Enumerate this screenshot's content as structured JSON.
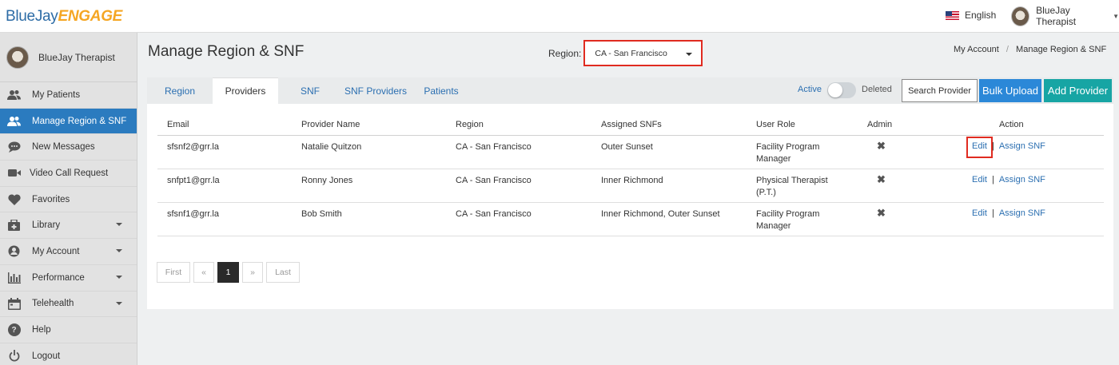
{
  "brand": {
    "part1": "BlueJay",
    "part2": "ENGAGE"
  },
  "header": {
    "language": "English",
    "user_name": "BlueJay Therapist"
  },
  "sidebar": {
    "user_name": "BlueJay Therapist",
    "items": [
      {
        "label": "My Patients",
        "icon": "patients-icon"
      },
      {
        "label": "Manage Region & SNF",
        "icon": "users-icon",
        "active": true
      },
      {
        "label": "New Messages",
        "icon": "chat-icon"
      },
      {
        "label": "Video Call Request",
        "icon": "video-icon"
      },
      {
        "label": "Favorites",
        "icon": "heart-icon"
      },
      {
        "label": "Library",
        "icon": "library-icon",
        "dropdown": true
      },
      {
        "label": "My Account",
        "icon": "account-icon",
        "dropdown": true
      },
      {
        "label": "Performance",
        "icon": "bar-chart-icon",
        "dropdown": true
      },
      {
        "label": "Telehealth",
        "icon": "calendar-icon",
        "dropdown": true
      },
      {
        "label": "Help",
        "icon": "help-icon"
      },
      {
        "label": "Logout",
        "icon": "power-icon"
      }
    ]
  },
  "page": {
    "title": "Manage Region & SNF",
    "region_label": "Region:",
    "region_value": "CA - San Francisco",
    "breadcrumb": [
      "My Account",
      "/",
      "Manage Region & SNF"
    ]
  },
  "tabs": [
    "Region",
    "Providers",
    "SNF",
    "SNF Providers",
    "Patients"
  ],
  "active_tab": "Providers",
  "toolbar": {
    "active_label": "Active",
    "deleted_label": "Deleted",
    "search_label": "Search Provider",
    "bulk_label": "Bulk Upload",
    "add_label": "Add Provider"
  },
  "table": {
    "headers": [
      "Email",
      "Provider Name",
      "Region",
      "Assigned SNFs",
      "User Role",
      "Admin",
      "Action"
    ],
    "rows": [
      {
        "email": "sfsnf2@grr.la",
        "name": "Natalie Quitzon",
        "region": "CA - San Francisco",
        "snfs": "Outer Sunset",
        "role": "Facility Program Manager",
        "admin": "✖",
        "edit": "Edit",
        "sep": "|",
        "assign": "Assign SNF"
      },
      {
        "email": "snfpt1@grr.la",
        "name": "Ronny Jones",
        "region": "CA - San Francisco",
        "snfs": "Inner Richmond",
        "role": "Physical Therapist (P.T.)",
        "admin": "✖",
        "edit": "Edit",
        "sep": "|",
        "assign": "Assign SNF"
      },
      {
        "email": "sfsnf1@grr.la",
        "name": "Bob Smith",
        "region": "CA - San Francisco",
        "snfs": "Inner Richmond, Outer Sunset",
        "role": "Facility Program Manager",
        "admin": "✖",
        "edit": "Edit",
        "sep": "|",
        "assign": "Assign SNF"
      }
    ]
  },
  "pager": {
    "first": "First",
    "prev": "«",
    "current": "1",
    "next": "»",
    "last": "Last"
  },
  "colors": {
    "primary": "#2b7bbf",
    "teal": "#17a5a4",
    "highlight": "#e02b20",
    "brand_orange": "#f5a623"
  }
}
